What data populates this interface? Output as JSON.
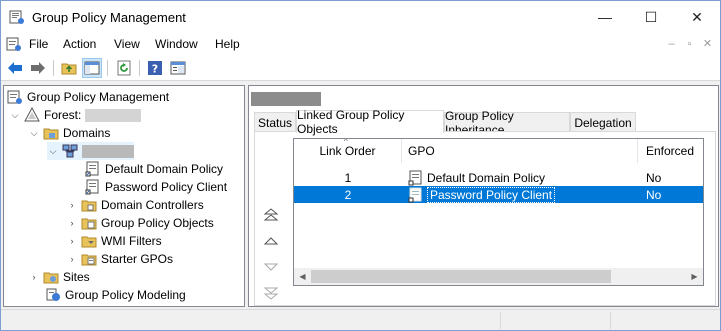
{
  "window": {
    "title": "Group Policy Management",
    "controls": {
      "minimize": "—",
      "maximize": "☐",
      "close": "✕"
    }
  },
  "menu": {
    "items": [
      "File",
      "Action",
      "View",
      "Window",
      "Help"
    ],
    "mdi_controls": {
      "minimize": "–",
      "restore": "▫",
      "close": "✕"
    }
  },
  "toolbar": {
    "buttons": [
      "back-icon",
      "forward-icon",
      "up-folder-icon",
      "show-hide-tree-icon",
      "refresh-icon",
      "help-icon",
      "properties-icon"
    ]
  },
  "tree": {
    "root": "Group Policy Management",
    "forest_label": "Forest:",
    "domains": "Domains",
    "domain_items": [
      "Default Domain Policy",
      "Password Policy Client",
      "Domain Controllers",
      "Group Policy Objects",
      "WMI Filters",
      "Starter GPOs"
    ],
    "sites": "Sites",
    "modeling": "Group Policy Modeling"
  },
  "right": {
    "tabs": [
      "Status",
      "Linked Group Policy Objects",
      "Group Policy Inheritance",
      "Delegation"
    ],
    "active_tab": "Linked Group Policy Objects",
    "columns": [
      "Link Order",
      "GPO",
      "Enforced"
    ],
    "rows": [
      {
        "order": "1",
        "gpo": "Default Domain Policy",
        "enforced": "No",
        "selected": false
      },
      {
        "order": "2",
        "gpo": "Password Policy Client",
        "enforced": "No",
        "selected": true
      }
    ]
  },
  "colors": {
    "selection": "#0078d7",
    "accent_blue": "#1c6fd1"
  }
}
